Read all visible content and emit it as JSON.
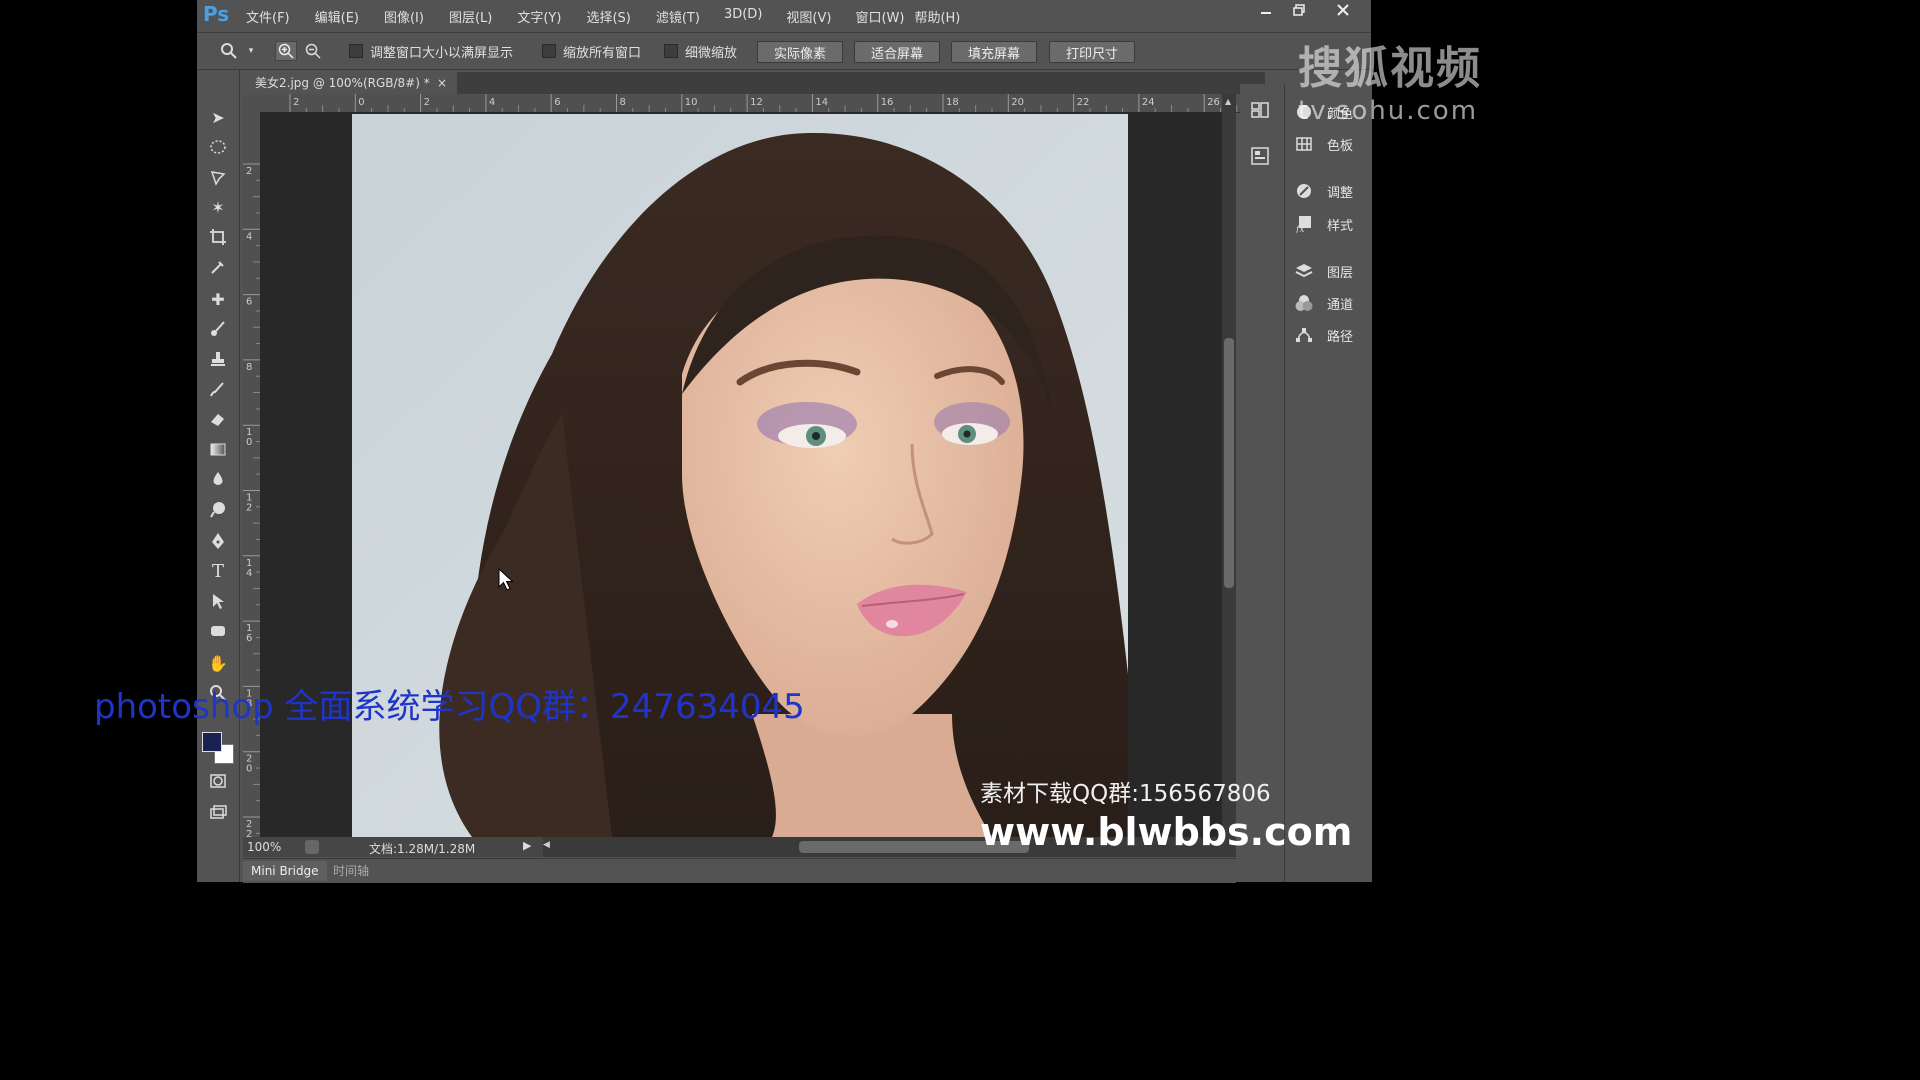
{
  "app": {
    "logo": "Ps",
    "menu": [
      "文件(F)",
      "编辑(E)",
      "图像(I)",
      "图层(L)",
      "文字(Y)",
      "选择(S)",
      "滤镜(T)",
      "3D(D)",
      "视图(V)",
      "窗口(W)",
      "帮助(H)"
    ]
  },
  "options": {
    "checkboxes": [
      "调整窗口大小以满屏显示",
      "缩放所有窗口",
      "细微缩放"
    ],
    "buttons": [
      "实际像素",
      "适合屏幕",
      "填充屏幕",
      "打印尺寸"
    ]
  },
  "document": {
    "tab_title": "美女2.jpg @ 100%(RGB/8#) *",
    "tab_close": "×"
  },
  "ruler": {
    "h_ticks": [
      "2",
      "0",
      "2",
      "4",
      "6",
      "8",
      "10",
      "12",
      "14",
      "16",
      "18",
      "20",
      "22",
      "24",
      "26"
    ],
    "v_ticks": [
      "2",
      "4",
      "6",
      "8",
      "1 0",
      "1 2",
      "1 4",
      "1 6",
      "1 8",
      "2 0",
      "2 2"
    ]
  },
  "status": {
    "zoom": "100%",
    "doc_info": "文档:1.28M/1.28M"
  },
  "bottom_tabs": [
    "Mini Bridge",
    "时间轴"
  ],
  "panels": [
    {
      "icon": "color-icon",
      "label": "颜色"
    },
    {
      "icon": "swatches-icon",
      "label": "色板"
    },
    {
      "icon": "adjustments-icon",
      "label": "调整"
    },
    {
      "icon": "styles-icon",
      "label": "样式"
    },
    {
      "icon": "layers-icon",
      "label": "图层"
    },
    {
      "icon": "channels-icon",
      "label": "通道"
    },
    {
      "icon": "paths-icon",
      "label": "路径"
    }
  ],
  "colors": {
    "foreground": "#1b2150",
    "background": "#ffffff"
  },
  "watermarks": {
    "sohu_brand": "搜狐视频",
    "sohu_url": "tv.sohu.com",
    "qq_group_caption": "photoshop 全面系统学习QQ群：247634045",
    "material_caption": "素材下载QQ群:156567806",
    "site": "www.blwbbs.com"
  }
}
